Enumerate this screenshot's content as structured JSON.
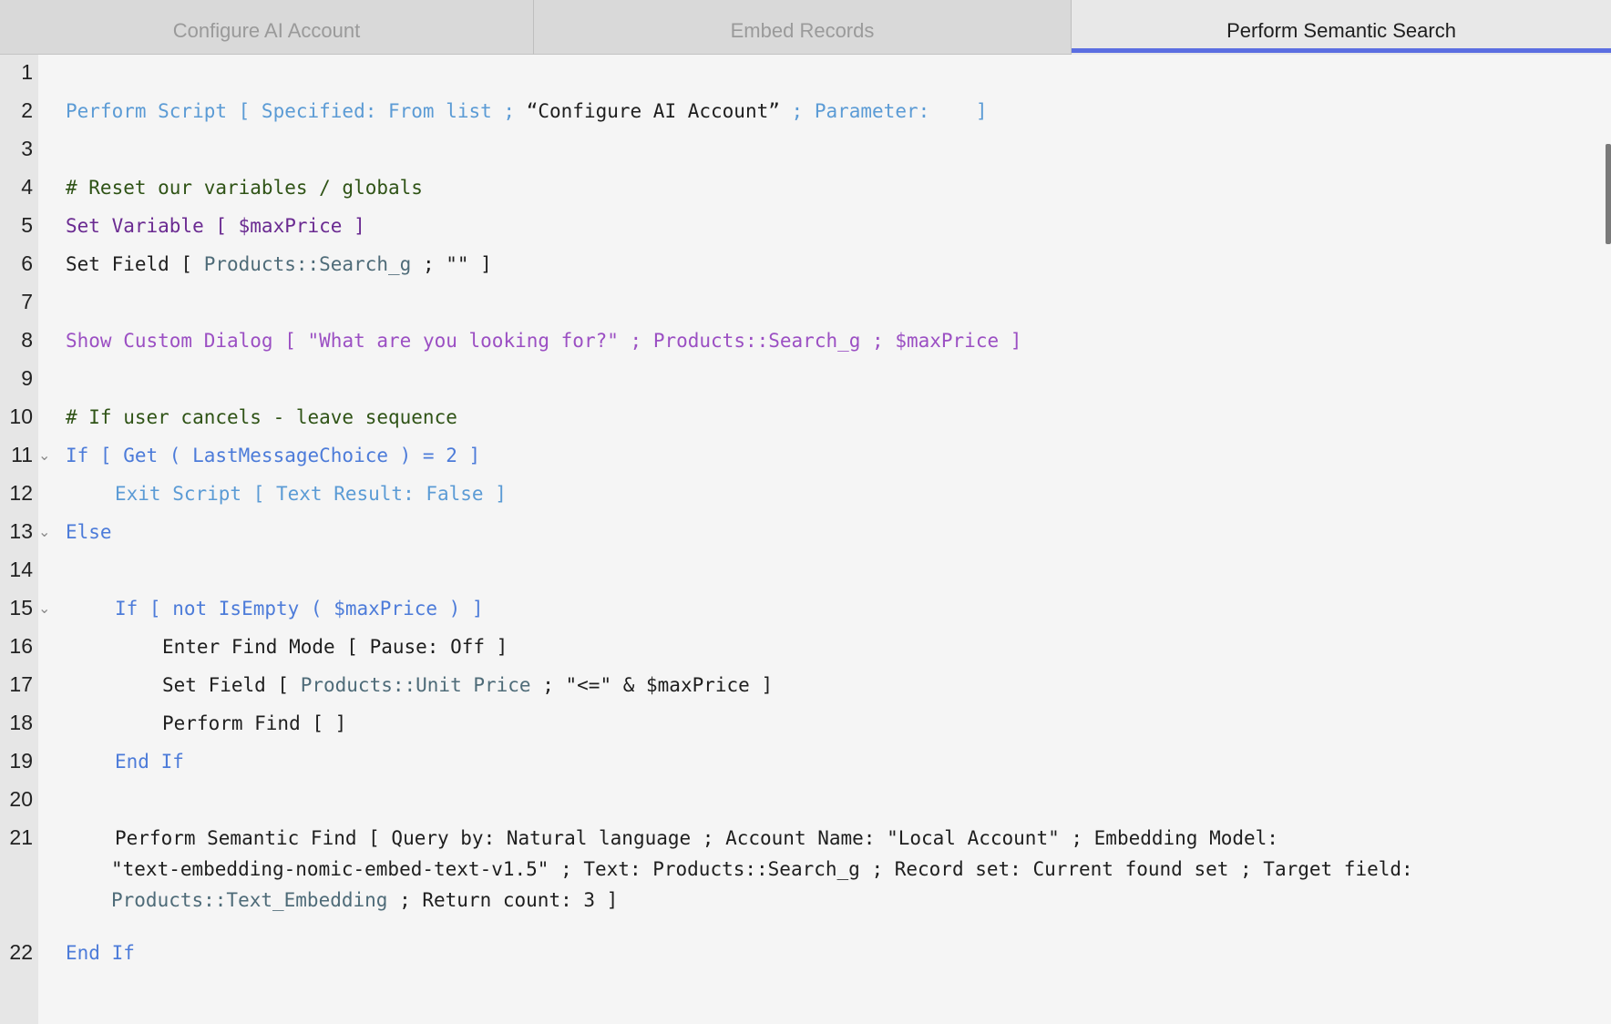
{
  "tabs": [
    {
      "label": "Configure AI Account"
    },
    {
      "label": "Embed Records"
    },
    {
      "label": "Perform Semantic Search"
    }
  ],
  "lines": {
    "n1": "1",
    "n2": "2",
    "n3": "3",
    "n4": "4",
    "n5": "5",
    "n6": "6",
    "n7": "7",
    "n8": "8",
    "n9": "9",
    "n10": "10",
    "n11": "11",
    "n12": "12",
    "n13": "13",
    "n14": "14",
    "n15": "15",
    "n16": "16",
    "n17": "17",
    "n18": "18",
    "n19": "19",
    "n20": "20",
    "n21": "21",
    "n22": "22"
  },
  "code": {
    "l2a": "Perform Script [ Specified: From list ; ",
    "l2b": "“Configure AI Account”",
    "l2c": " ; Parameter:    ]",
    "l4": "# Reset our variables / globals",
    "l5": "Set Variable [ $maxPrice ]",
    "l6a": "Set Field [ ",
    "l6b": "Products::Search_g",
    "l6c": " ; \"\" ]",
    "l8a": "Show Custom Dialog [ ",
    "l8b": "\"What are you looking for?\"",
    "l8c": " ; Products::Search_g ; $maxPrice ]",
    "l10": "# If user cancels - leave sequence",
    "l11": "If [ Get ( LastMessageChoice ) = 2 ]",
    "l12": "Exit Script [ Text Result: False ]",
    "l13": "Else",
    "l15": "If [ not IsEmpty ( $maxPrice ) ]",
    "l16": "Enter Find Mode [ Pause: Off ]",
    "l17a": "Set Field [ ",
    "l17b": "Products::Unit Price",
    "l17c": " ; \"<=\" & $maxPrice ]",
    "l18": "Perform Find [ ]",
    "l19": "End If",
    "l21a": "Perform Semantic Find [ Query by: Natural language ; Account Name: \"Local Account\" ; Embedding Model:",
    "l21b": "\"text-embedding-nomic-embed-text-v1.5\" ; Text: Products::Search_g ; Record set: Current found set ; Target field:",
    "l21c": "Products::Text_Embedding",
    "l21d": " ; Return count: 3 ]",
    "l22": "End If"
  },
  "colors": {
    "accent": "#5b6ee1",
    "keyword_blue": "#4c7bd9",
    "comment_green": "#2f5316",
    "variable_purple": "#6a2a91",
    "dialog_magenta": "#9b4fc3",
    "field_grey": "#4e6b78"
  },
  "icons": {
    "fold": "chevron-down-icon"
  }
}
